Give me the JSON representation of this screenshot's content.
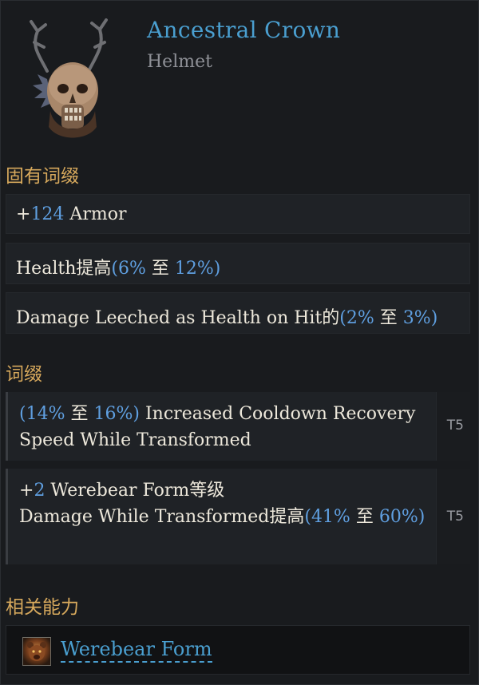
{
  "item": {
    "name": "Ancestral Crown",
    "type": "Helmet",
    "icon": "antlered-skull-helmet-icon"
  },
  "implicit": {
    "title": "固有词缀",
    "rows": [
      {
        "pre": "+",
        "num": "124",
        "post": " Armor"
      },
      {
        "label": "Health提高",
        "min": "6%",
        "sep": " 至 ",
        "max": "12%"
      },
      {
        "label": "Damage Leeched as Health on Hit的",
        "min": "2%",
        "sep": " 至 ",
        "max": "3%"
      }
    ]
  },
  "affixes": {
    "title": "词缀",
    "rows": [
      {
        "min": "14%",
        "sep": " 至 ",
        "max": "16%",
        "text": " Increased Cooldown Recovery Speed While Transformed",
        "tier": "T5"
      },
      {
        "pre": "+",
        "num": "2",
        "line1": " Werebear Form等级",
        "line2_text": "Damage While Transformed提高",
        "min": "41%",
        "sep": " 至 ",
        "max": "60%",
        "tier": "T5"
      }
    ]
  },
  "abilities": {
    "title": "相关能力",
    "items": [
      {
        "name": "Werebear Form",
        "icon": "werebear-icon"
      }
    ]
  },
  "colors": {
    "item_name": "#4a9fd0",
    "section_title": "#d6a85c",
    "value_number": "#5f9fe0",
    "background": "#191b1e"
  }
}
